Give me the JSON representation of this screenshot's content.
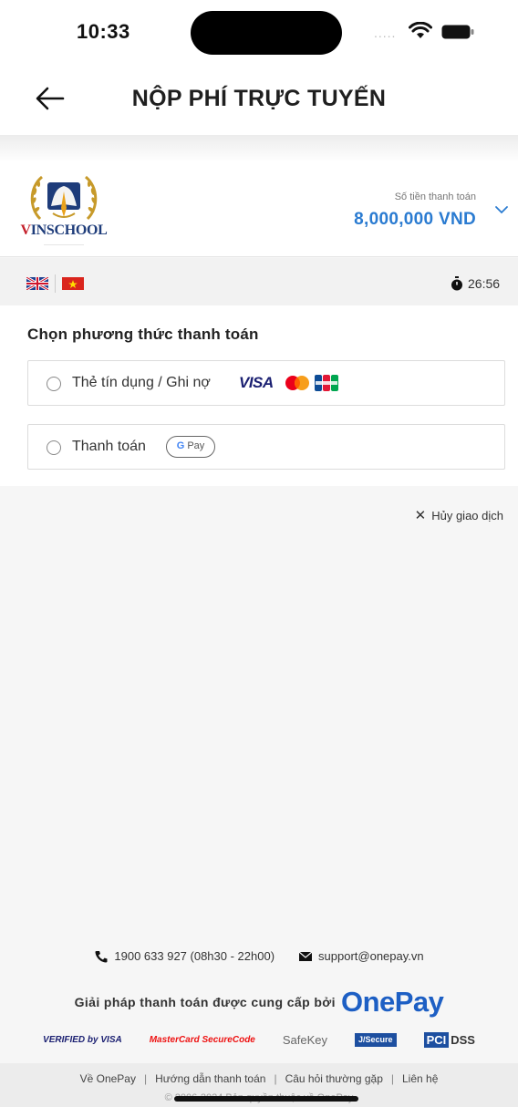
{
  "status_bar": {
    "time": "10:33",
    "signal": "....."
  },
  "nav": {
    "title": "NỘP PHÍ TRỰC TUYẾN"
  },
  "merchant": {
    "logo_text_v": "V",
    "logo_text_rest": "INSCHOOL",
    "amount_label": "Số tiền thanh toán",
    "amount_value": "8,000,000 VND"
  },
  "session": {
    "timer": "26:56"
  },
  "payment": {
    "title": "Chọn phương thức thanh toán",
    "card_label": "Thẻ tín dụng / Ghi nợ",
    "card_brand_visa": "VISA",
    "gpay_label": "Thanh toán",
    "gpay_g": "G",
    "gpay_text": "Pay"
  },
  "cancel_label": "Hủy giao dịch",
  "cancel_symbol": "✕",
  "contact": {
    "phone": "1900 633 927 (08h30 - 22h00)",
    "email": "support@onepay.vn"
  },
  "provider": {
    "text": "Giải pháp thanh toán được cung cấp bởi",
    "brand": "OnePay"
  },
  "security_badges": {
    "visa": "VERIFIED by VISA",
    "mastercard": "MasterCard SecureCode",
    "safekey": "SafeKey",
    "jcb": "J/Secure",
    "pci": "PCI",
    "dss": "DSS"
  },
  "footer": {
    "links": [
      "Về OnePay",
      "Hướng dẫn thanh toán",
      "Câu hỏi thường gặp",
      "Liên hệ"
    ],
    "copyright": "© 2006-2024 Bản quyền thuộc về OnePay"
  },
  "colors": {
    "accent": "#2a7bd1",
    "brand": "#1d5fc4",
    "navy": "#1e3c7a"
  }
}
